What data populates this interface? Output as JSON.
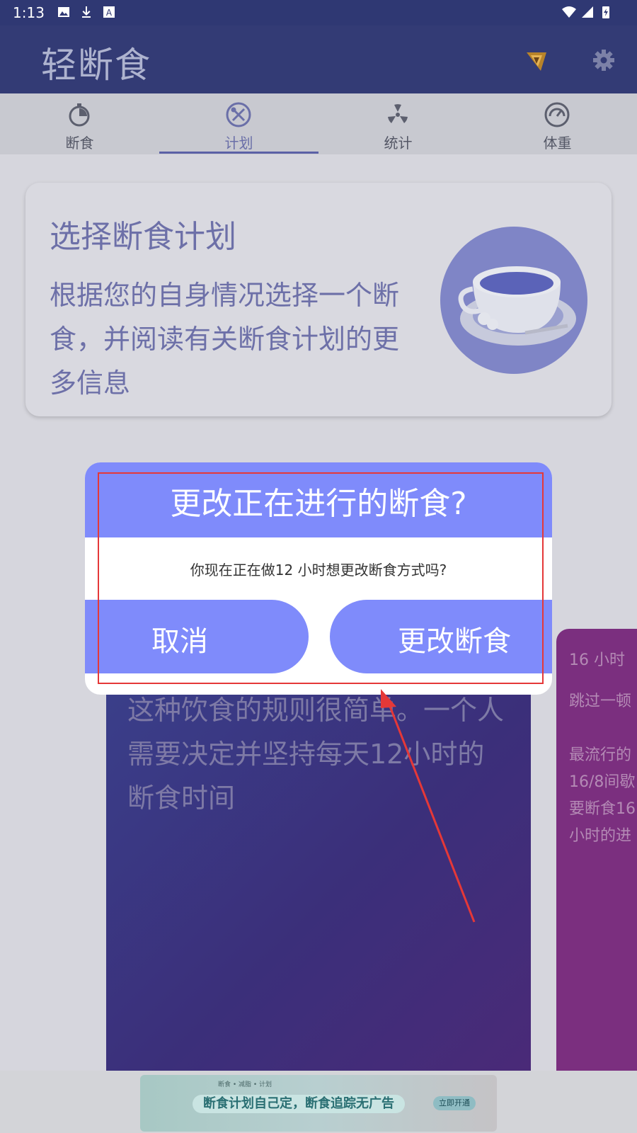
{
  "status_bar": {
    "time": "1:13"
  },
  "app_bar": {
    "title": "轻断食"
  },
  "tabs": [
    {
      "label": "断食",
      "icon": "stopwatch-icon"
    },
    {
      "label": "计划",
      "icon": "fork-spoon-icon",
      "active": true
    },
    {
      "label": "统计",
      "icon": "radiation-icon"
    },
    {
      "label": "体重",
      "icon": "scale-gauge-icon"
    }
  ],
  "info_card": {
    "title": "选择断食计划",
    "description": "根据您的自身情况选择一个断食，并阅读有关断食计划的更多信息"
  },
  "plan_cards": {
    "main_text": "这种饮食的规则很简单。一个人需要决定并坚持每天12小时的断食时间",
    "side_title": "16 小时",
    "side_desc_1": "跳过一顿",
    "side_desc_2": "最流行的",
    "side_desc_3": "16/8间歇",
    "side_desc_4": "要断食16",
    "side_desc_5": "小时的进"
  },
  "ad": {
    "tag": "断食 • 减脂 • 计划",
    "text": "断食计划自己定，断食追踪无广告",
    "button": "立即开通"
  },
  "dialog": {
    "title": "更改正在进行的断食?",
    "message": "你现在正在做12 小时想更改断食方式吗?",
    "cancel_label": "取消",
    "confirm_label": "更改断食"
  },
  "colors": {
    "app_bar": "#333b75",
    "dialog_accent": "#7f8bfb",
    "annotation": "#e53838"
  }
}
